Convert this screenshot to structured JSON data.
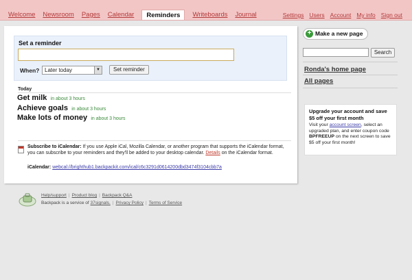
{
  "nav": {
    "tabs": [
      {
        "label": "Welcome"
      },
      {
        "label": "Newsroom"
      },
      {
        "label": "Pages"
      },
      {
        "label": "Calendar"
      },
      {
        "label": "Reminders",
        "active": true
      },
      {
        "label": "Writeboards"
      },
      {
        "label": "Journal"
      }
    ],
    "right_links": [
      {
        "label": "Settings"
      },
      {
        "label": "Users"
      },
      {
        "label": "Account"
      },
      {
        "label": "My info"
      },
      {
        "label": "Sign out"
      }
    ]
  },
  "reminder_form": {
    "title": "Set a reminder",
    "input_value": "",
    "when_label": "When?",
    "when_selected": "Later today",
    "submit_label": "Set reminder"
  },
  "today": {
    "heading": "Today",
    "items": [
      {
        "text": "Get milk",
        "time": "in about 3 hours"
      },
      {
        "text": "Achieve goals",
        "time": "in about 3 hours"
      },
      {
        "text": "Make lots of money",
        "time": "in about 3 hours"
      }
    ]
  },
  "ical": {
    "heading": "Subscribe to iCalendar:",
    "body": "If you use Apple iCal, Mozilla Calendar, or another program that supports the iCalendar format, you can subscribe to your reminders and they'll be added to your desktop calendar.",
    "details_link": "Details",
    "details_suffix": "on the iCalendar format.",
    "url_label": "iCalendar:",
    "url": "webcal://brighthub1.backpackit.com/ical/c6c3291d0614200dbd3474f3104cbb7a"
  },
  "footer": {
    "links": [
      "Help/support",
      "Product blog",
      "Backpack Q&A"
    ],
    "service_prefix": "Backpack is a service of",
    "service_link": "37signals.",
    "legal_links": [
      "Privacy Policy",
      "Terms of Service"
    ]
  },
  "sidebar": {
    "new_page_label": "Make a new page",
    "search_value": "",
    "search_button": "Search",
    "links": [
      "Ronda's home page",
      "All pages"
    ],
    "upgrade": {
      "heading": "Upgrade your account and save $5 off your first month",
      "body_prefix": "Visit your",
      "account_link": "account screen",
      "body_mid": ", select an upgraded plan, and enter coupon code",
      "code": "BPFREEUP",
      "body_suffix": "on the next screen to save $5 off your first month!"
    }
  },
  "colors": {
    "topbar": "#f3c6c6",
    "link": "#b33a3a",
    "time_green": "#3a8a3a",
    "reminder_box": "#eaf1fb"
  }
}
